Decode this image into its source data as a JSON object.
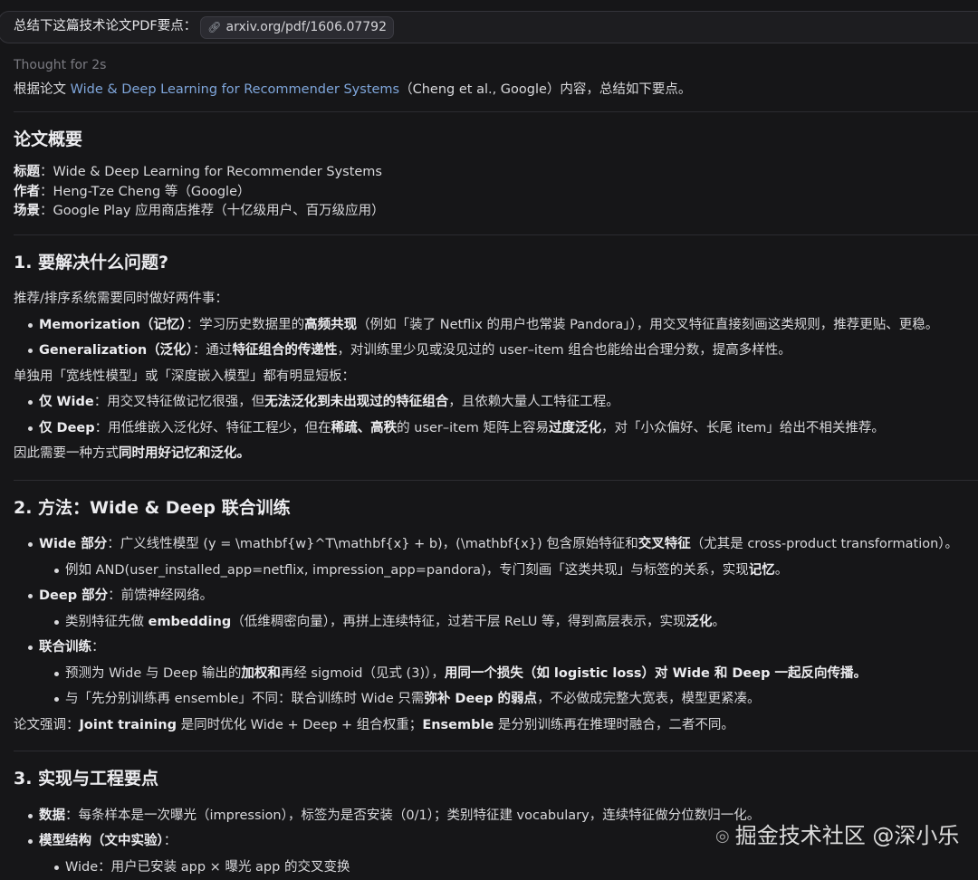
{
  "prompt": {
    "text": "总结下这篇技术论文PDF要点：",
    "link": "arxiv.org/pdf/1606.07792"
  },
  "thought": "Thought for 2s",
  "intro": {
    "prefix": "根据论文 ",
    "title": "Wide & Deep Learning for Recommender Systems",
    "suffix": "（Cheng et al., Google）内容，总结如下要点。"
  },
  "overview": {
    "heading": "论文概要",
    "title_label": "标题",
    "title_value": "：Wide & Deep Learning for Recommender Systems",
    "author_label": "作者",
    "author_value": "：Heng-Tze Cheng 等（Google）",
    "scene_label": "场景",
    "scene_value": "：Google Play 应用商店推荐（十亿级用户、百万级应用）"
  },
  "s1": {
    "heading": "1. 要解决什么问题?",
    "p1": "推荐/排序系统需要同时做好两件事：",
    "b1_bold": "Memorization（记忆）",
    "b1_a": "：学习历史数据里的",
    "b1_bold2": "高频共现",
    "b1_b": "（例如「装了 Netflix 的用户也常装 Pandora」），用交叉特征直接刻画这类规则，推荐更贴、更稳。",
    "b2_bold": "Generalization（泛化）",
    "b2_a": "：通过",
    "b2_bold2": "特征组合的传递性",
    "b2_b": "，对训练里少见或没见过的 user–item 组合也能给出合理分数，提高多样性。",
    "p2": "单独用「宽线性模型」或「深度嵌入模型」都有明显短板：",
    "b3_bold": "仅 Wide",
    "b3_a": "：用交叉特征做记忆很强，但",
    "b3_bold2": "无法泛化到未出现过的特征组合",
    "b3_b": "，且依赖大量人工特征工程。",
    "b4_bold": "仅 Deep",
    "b4_a": "：用低维嵌入泛化好、特征工程少，但在",
    "b4_bold2": "稀疏、高秩",
    "b4_b": "的 user–item 矩阵上容易",
    "b4_bold3": "过度泛化",
    "b4_c": "，对「小众偏好、长尾 item」给出不相关推荐。",
    "p3_a": "因此需要一种方式",
    "p3_bold": "同时用好记忆和泛化。"
  },
  "s2": {
    "heading": "2. 方法：Wide & Deep 联合训练",
    "b1_bold": "Wide 部分",
    "b1_a": "：广义线性模型 (y = \\mathbf{w}^T\\mathbf{x} + b)，(\\mathbf{x}) 包含原始特征和",
    "b1_bold2": "交叉特征",
    "b1_b": "（尤其是 cross-product transformation）。",
    "b1s_a": "例如 AND(user_installed_app=netflix, impression_app=pandora)，专门刻画「这类共现」与标签的关系，实现",
    "b1s_bold": "记忆",
    "b1s_b": "。",
    "b2_bold": "Deep 部分",
    "b2_a": "：前馈神经网络。",
    "b2s_a": "类别特征先做 ",
    "b2s_bold": "embedding",
    "b2s_b": "（低维稠密向量），再拼上连续特征，过若干层 ReLU 等，得到高层表示，实现",
    "b2s_bold2": "泛化",
    "b2s_c": "。",
    "b3_bold": "联合训练",
    "b3_a": "：",
    "b3s1_a": "预测为 Wide 与 Deep 输出的",
    "b3s1_bold": "加权和",
    "b3s1_b": "再经 sigmoid（见式 (3)），",
    "b3s1_bold2": "用同一个损失（如 logistic loss）对 Wide 和 Deep 一起反向传播。",
    "b3s2_a": "与「先分别训练再 ensemble」不同：联合训练时 Wide 只需",
    "b3s2_bold": "弥补 Deep 的弱点",
    "b3s2_b": "，不必做成完整大宽表，模型更紧凑。",
    "p_a": "论文强调：",
    "p_bold": "Joint training",
    "p_b": " 是同时优化 Wide + Deep + 组合权重；",
    "p_bold2": "Ensemble",
    "p_c": " 是分别训练再在推理时融合，二者不同。"
  },
  "s3": {
    "heading": "3. 实现与工程要点",
    "b1_bold": "数据",
    "b1_a": "：每条样本是一次曝光（impression），标签为是否安装（0/1）；类别特征建 vocabulary，连续特征做分位数归一化。",
    "b2_bold": "模型结构（文中实验）",
    "b2_a": "：",
    "b2s": "Wide：用户已安装 app × 曝光 app 的交叉变换"
  },
  "watermark": "掘金技术社区 @深小乐"
}
